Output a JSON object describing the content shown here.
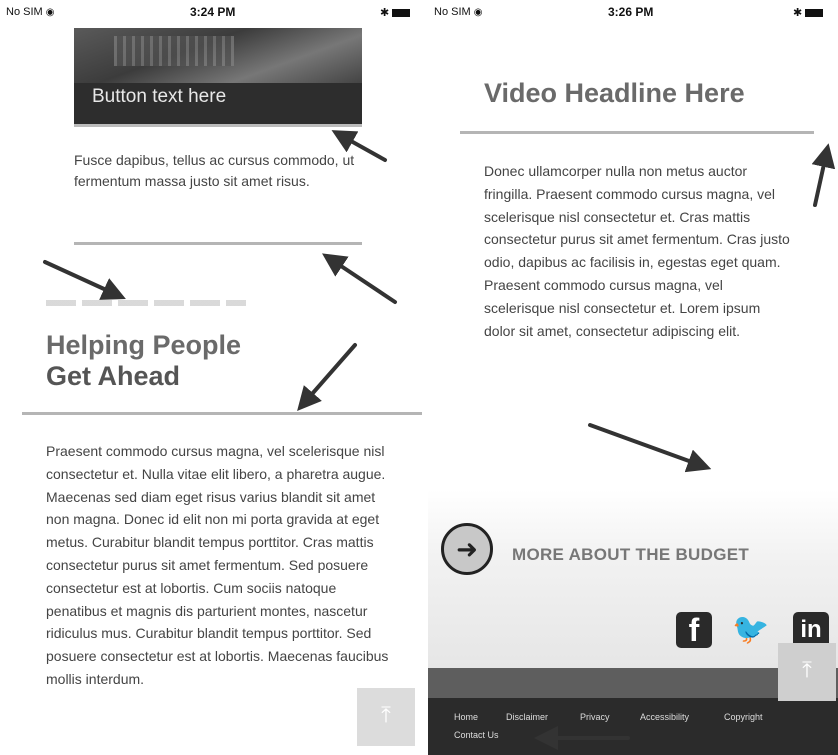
{
  "left": {
    "status": {
      "carrier": "No SIM",
      "time": "3:24 PM"
    },
    "hero": {
      "button_text": "Button text here"
    },
    "intro_text": "Fusce dapibus, tellus ac cursus commodo, ut fermentum massa justo sit amet risus.",
    "heading": {
      "line1": "Helping People",
      "line2": "Get Ahead"
    },
    "body_text": "Praesent commodo cursus magna, vel scelerisque nisl consectetur et. Nulla vitae elit libero, a pharetra augue. Maecenas sed diam eget risus varius blandit sit amet non magna. Donec id elit non mi porta gravida at eget metus. Curabitur blandit tempus porttitor. Cras mattis consectetur purus sit amet fermentum. Sed posuere consectetur est at lobortis. Cum sociis natoque penatibus et magnis dis parturient montes, nascetur ridiculus mus. Curabitur blandit tempus porttitor. Sed posuere consectetur est at lobortis. Maecenas faucibus mollis interdum."
  },
  "right": {
    "status": {
      "carrier": "No SIM",
      "time": "3:26 PM"
    },
    "video_headline": "Video Headline Here",
    "body_text": "Donec ullamcorper nulla non metus auctor fringilla. Praesent commodo cursus magna, vel scelerisque nisl consectetur et. Cras mattis consectetur purus sit amet fermentum. Cras justo odio, dapibus ac facilisis in, egestas eget quam. Praesent commodo cursus magna, vel scelerisque nisl consectetur et. Lorem ipsum dolor sit amet, consectetur adipiscing elit.",
    "more_link": "MORE ABOUT THE BUDGET",
    "social": {
      "facebook": "f",
      "linkedin": "in"
    },
    "footer_links": [
      "Home",
      "Disclaimer",
      "Privacy",
      "Accessibility",
      "Copyright",
      "Contact Us"
    ]
  },
  "icons": [
    "wifi-icon",
    "battery-icon",
    "back-to-top-icon",
    "arrow-right-circle-icon",
    "facebook-icon",
    "twitter-icon",
    "linkedin-icon"
  ]
}
